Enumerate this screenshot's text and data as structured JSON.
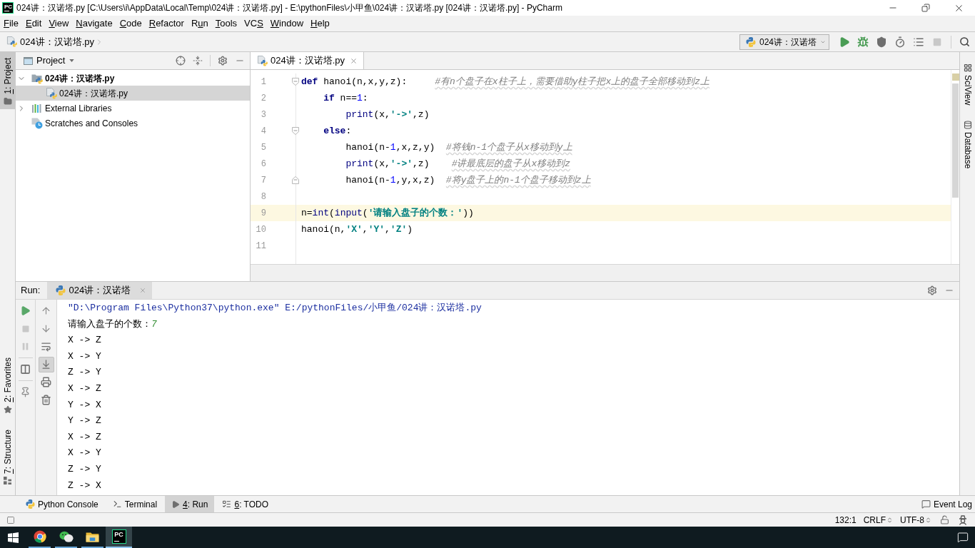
{
  "window": {
    "logo_text": "PC",
    "title": "024讲：汉诺塔.py [C:\\Users\\i\\AppData\\Local\\Temp\\024讲：汉诺塔.py] - E:\\pythonFiles\\小甲鱼\\024讲：汉诺塔.py [024讲：汉诺塔.py] - PyCharm"
  },
  "menu": [
    {
      "key": "F",
      "post": "ile"
    },
    {
      "key": "E",
      "post": "dit"
    },
    {
      "key": "V",
      "post": "iew"
    },
    {
      "key": "N",
      "post": "avigate"
    },
    {
      "key": "C",
      "post": "ode"
    },
    {
      "key": "R",
      "post": "efactor"
    },
    {
      "pre": "R",
      "key": "u",
      "post": "n"
    },
    {
      "key": "T",
      "post": "ools"
    },
    {
      "pre": "VC",
      "key": "S"
    },
    {
      "key": "W",
      "post": "indow"
    },
    {
      "key": "H",
      "post": "elp"
    }
  ],
  "navigation_bar": {
    "breadcrumb": "024讲：汉诺塔.py",
    "run_configuration": "024讲：汉诺塔",
    "actions": [
      {
        "kind": "run",
        "disabled": false
      },
      {
        "kind": "debug",
        "disabled": false
      },
      {
        "kind": "coverage",
        "disabled": false
      },
      {
        "kind": "profile",
        "disabled": false
      },
      {
        "kind": "concurrency",
        "disabled": false
      },
      {
        "kind": "stop",
        "disabled": true
      }
    ]
  },
  "left_stripe": {
    "top_tabs": [
      {
        "key": "1",
        "post": ": Project",
        "kind": "project",
        "selected": true
      }
    ],
    "bottom_tabs": [
      {
        "key": "2",
        "post": ": Favorites",
        "kind": "favorites",
        "selected": false
      },
      {
        "key": "7",
        "post": ": Structure",
        "kind": "structure",
        "selected": false
      }
    ]
  },
  "project_panel": {
    "title": "Project",
    "tree": [
      {
        "label": "024讲：汉诺塔.py",
        "kind": "project",
        "expanded": true,
        "selected": false,
        "children": [
          {
            "label": "024讲：汉诺塔.py",
            "kind": "python-file",
            "selected": true
          }
        ]
      },
      {
        "label": "External Libraries",
        "kind": "libraries",
        "expanded": false,
        "selected": false
      },
      {
        "label": "Scratches and Consoles",
        "kind": "scratches",
        "selected": false
      }
    ]
  },
  "editor": {
    "tabs": [
      {
        "label": "024讲：汉诺塔.py",
        "selected": true
      }
    ],
    "lines": [
      {
        "number": "1",
        "current": false,
        "fold_start": true,
        "tokens": [
          {
            "kind": "keyword",
            "text": "def"
          },
          {
            "kind": "plain",
            "text": " hanoi(n,x,y,z):     "
          },
          {
            "kind": "comment",
            "text": "#有n个盘子在x柱子上，需要借助y柱子把x上的盘子全部移动到z上"
          }
        ],
        "children": [
          {
            "number": "2",
            "current": false,
            "tokens": [
              {
                "kind": "keyword",
                "text": "if"
              },
              {
                "kind": "plain",
                "text": " n=="
              },
              {
                "kind": "number",
                "text": "1"
              },
              {
                "kind": "plain",
                "text": ":"
              }
            ],
            "children": [
              {
                "number": "3",
                "current": false,
                "tokens": [
                  {
                    "kind": "builtin",
                    "text": "print"
                  },
                  {
                    "kind": "plain",
                    "text": "(x,"
                  },
                  {
                    "kind": "string",
                    "text": "'->'"
                  },
                  {
                    "kind": "plain",
                    "text": ",z)"
                  }
                ]
              }
            ]
          },
          {
            "number": "4",
            "current": false,
            "fold_start": true,
            "tokens": [
              {
                "kind": "keyword",
                "text": "else"
              },
              {
                "kind": "plain",
                "text": ":"
              }
            ],
            "children": [
              {
                "number": "5",
                "current": false,
                "tokens": [
                  {
                    "kind": "plain",
                    "text": "hanoi(n-"
                  },
                  {
                    "kind": "number",
                    "text": "1"
                  },
                  {
                    "kind": "plain",
                    "text": ",x,z,y)  "
                  },
                  {
                    "kind": "comment",
                    "text": "#将钱n-1个盘子从x移动到y上"
                  }
                ]
              },
              {
                "number": "6",
                "current": false,
                "tokens": [
                  {
                    "kind": "builtin",
                    "text": "print"
                  },
                  {
                    "kind": "plain",
                    "text": "(x,"
                  },
                  {
                    "kind": "string",
                    "text": "'->'"
                  },
                  {
                    "kind": "plain",
                    "text": ",z)    "
                  },
                  {
                    "kind": "comment",
                    "text": "#讲最底层的盘子从x移动到z"
                  }
                ]
              },
              {
                "number": "7",
                "current": false,
                "fold_end": true,
                "tokens": [
                  {
                    "kind": "plain",
                    "text": "hanoi(n-"
                  },
                  {
                    "kind": "number",
                    "text": "1"
                  },
                  {
                    "kind": "plain",
                    "text": ",y,x,z)  "
                  },
                  {
                    "kind": "comment",
                    "text": "#将y盘子上的n-1个盘子移动到z上"
                  }
                ]
              }
            ]
          }
        ]
      },
      {
        "number": "8",
        "current": false
      },
      {
        "number": "9",
        "current": true,
        "tokens": [
          {
            "kind": "plain",
            "text": "n="
          },
          {
            "kind": "builtin",
            "text": "int"
          },
          {
            "kind": "plain",
            "text": "("
          },
          {
            "kind": "builtin",
            "text": "input"
          },
          {
            "kind": "plain",
            "text": "("
          },
          {
            "kind": "string",
            "text": "'请输入盘子的个数：'"
          },
          {
            "kind": "plain",
            "text": "))"
          }
        ]
      },
      {
        "number": "10",
        "current": false,
        "tokens": [
          {
            "kind": "plain",
            "text": "hanoi(n,"
          },
          {
            "kind": "string",
            "text": "'X'"
          },
          {
            "kind": "plain",
            "text": ","
          },
          {
            "kind": "string",
            "text": "'Y'"
          },
          {
            "kind": "plain",
            "text": ","
          },
          {
            "kind": "string",
            "text": "'Z'"
          },
          {
            "kind": "plain",
            "text": ")"
          }
        ]
      },
      {
        "number": "11",
        "current": false
      }
    ]
  },
  "right_stripe": {
    "tabs": [
      {
        "label": "SciView",
        "kind": "sciview",
        "selected": false
      },
      {
        "label": "Database",
        "kind": "database",
        "selected": false
      }
    ]
  },
  "run_panel": {
    "title": "Run:",
    "tabs": [
      {
        "label": "024讲：汉诺塔",
        "selected": true
      }
    ],
    "toolbar": [
      {
        "kind": "rerun",
        "disabled": false
      },
      {
        "kind": "stop",
        "disabled": true
      },
      {
        "kind": "pause",
        "disabled": true
      },
      {
        "kind": "layout",
        "disabled": false
      },
      {
        "kind": "pin",
        "disabled": false
      }
    ],
    "console_toolbar": [
      {
        "kind": "up",
        "on": false
      },
      {
        "kind": "down",
        "on": false
      },
      {
        "kind": "soft-wrap",
        "on": false
      },
      {
        "kind": "scroll-to-end",
        "on": true
      },
      {
        "kind": "print",
        "on": false
      },
      {
        "kind": "clear",
        "on": false
      }
    ],
    "console": [
      {
        "kind": "command",
        "text": "\"D:\\Program Files\\Python37\\python.exe\" E:/pythonFiles/小甲鱼/024讲：汉诺塔.py"
      },
      {
        "kind": "prompt",
        "text": "请输入盘子的个数：",
        "input": "7"
      },
      {
        "kind": "output",
        "text": "X -> Z"
      },
      {
        "kind": "output",
        "text": "X -> Y"
      },
      {
        "kind": "output",
        "text": "Z -> Y"
      },
      {
        "kind": "output",
        "text": "X -> Z"
      },
      {
        "kind": "output",
        "text": "Y -> X"
      },
      {
        "kind": "output",
        "text": "Y -> Z"
      },
      {
        "kind": "output",
        "text": "X -> Z"
      },
      {
        "kind": "output",
        "text": "X -> Y"
      },
      {
        "kind": "output",
        "text": "Z -> Y"
      },
      {
        "kind": "output",
        "text": "Z -> X"
      }
    ]
  },
  "tool_window_bar": {
    "tabs": [
      {
        "label": "Python Console",
        "kind": "python-console",
        "selected": false
      },
      {
        "label": "Terminal",
        "kind": "terminal",
        "selected": false
      },
      {
        "key": "4",
        "post": ": Run",
        "kind": "run",
        "selected": true
      },
      {
        "key": "6",
        "post": ": TODO",
        "kind": "todo",
        "selected": false
      }
    ],
    "event_log": "Event Log"
  },
  "status_bar": {
    "position": "132:1",
    "line_separator": "CRLF",
    "encoding": "UTF-8"
  },
  "taskbar": {
    "apps": [
      {
        "kind": "browser",
        "selected": false,
        "running": true
      },
      {
        "kind": "chat",
        "selected": false,
        "running": true
      },
      {
        "kind": "explorer",
        "selected": false,
        "running": true
      },
      {
        "kind": "pycharm",
        "selected": true,
        "running": true,
        "logo_text": "PC"
      }
    ]
  }
}
